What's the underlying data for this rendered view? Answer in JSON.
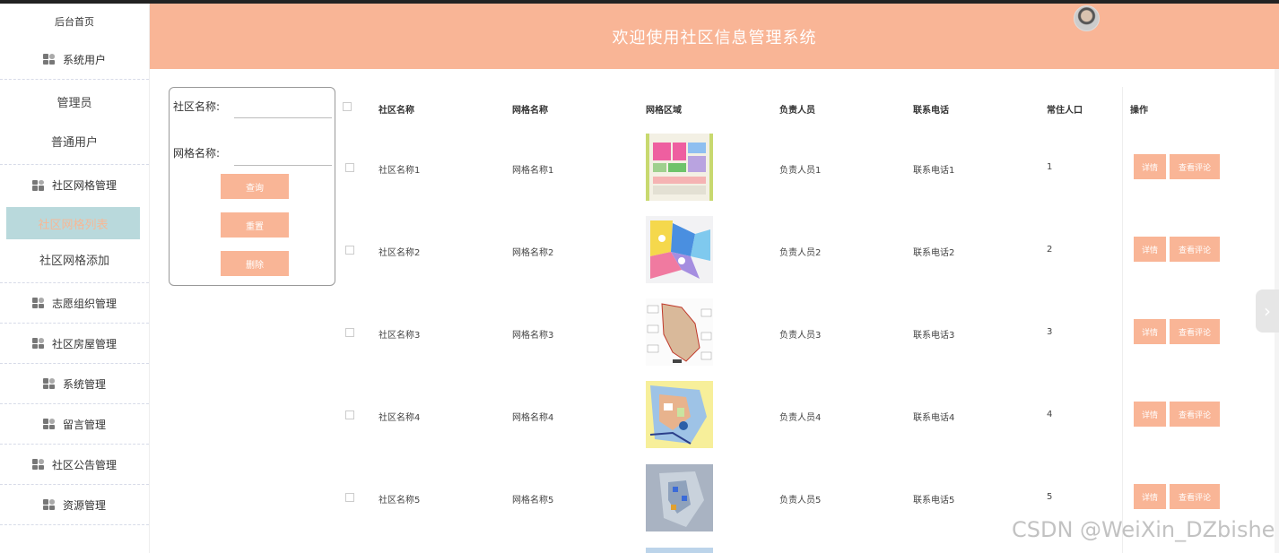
{
  "header": {
    "title": "欢迎使用社区信息管理系统"
  },
  "sidebar": {
    "home": "后台首页",
    "system_users": "系统用户",
    "system_users_sub": [
      "管理员",
      "普通用户"
    ],
    "grid_mgmt": "社区网格管理",
    "grid_sub": [
      "社区网格列表",
      "社区网格添加"
    ],
    "items": [
      "志愿组织管理",
      "社区房屋管理",
      "系统管理",
      "留言管理",
      "社区公告管理",
      "资源管理"
    ]
  },
  "search": {
    "community_label": "社区名称:",
    "grid_label": "网格名称:",
    "query_btn": "查询",
    "reset_btn": "重置",
    "delete_btn": "删除"
  },
  "table": {
    "headers": [
      "社区名称",
      "网格名称",
      "网格区域",
      "负责人员",
      "联系电话",
      "常住人口",
      "操作"
    ],
    "rows": [
      {
        "community": "社区名称1",
        "grid": "网格名称1",
        "person": "负责人员1",
        "phone": "联系电话1",
        "pop": "1"
      },
      {
        "community": "社区名称2",
        "grid": "网格名称2",
        "person": "负责人员2",
        "phone": "联系电话2",
        "pop": "2"
      },
      {
        "community": "社区名称3",
        "grid": "网格名称3",
        "person": "负责人员3",
        "phone": "联系电话3",
        "pop": "3"
      },
      {
        "community": "社区名称4",
        "grid": "网格名称4",
        "person": "负责人员4",
        "phone": "联系电话4",
        "pop": "4"
      },
      {
        "community": "社区名称5",
        "grid": "网格名称5",
        "person": "负责人员5",
        "phone": "联系电话5",
        "pop": "5"
      }
    ],
    "detail_btn": "详情",
    "comment_btn": "查看评论"
  },
  "watermark": "CSDN @WeiXin_DZbishe",
  "colors": {
    "accent": "#f9b596",
    "active_bg": "#b9d9dc"
  }
}
